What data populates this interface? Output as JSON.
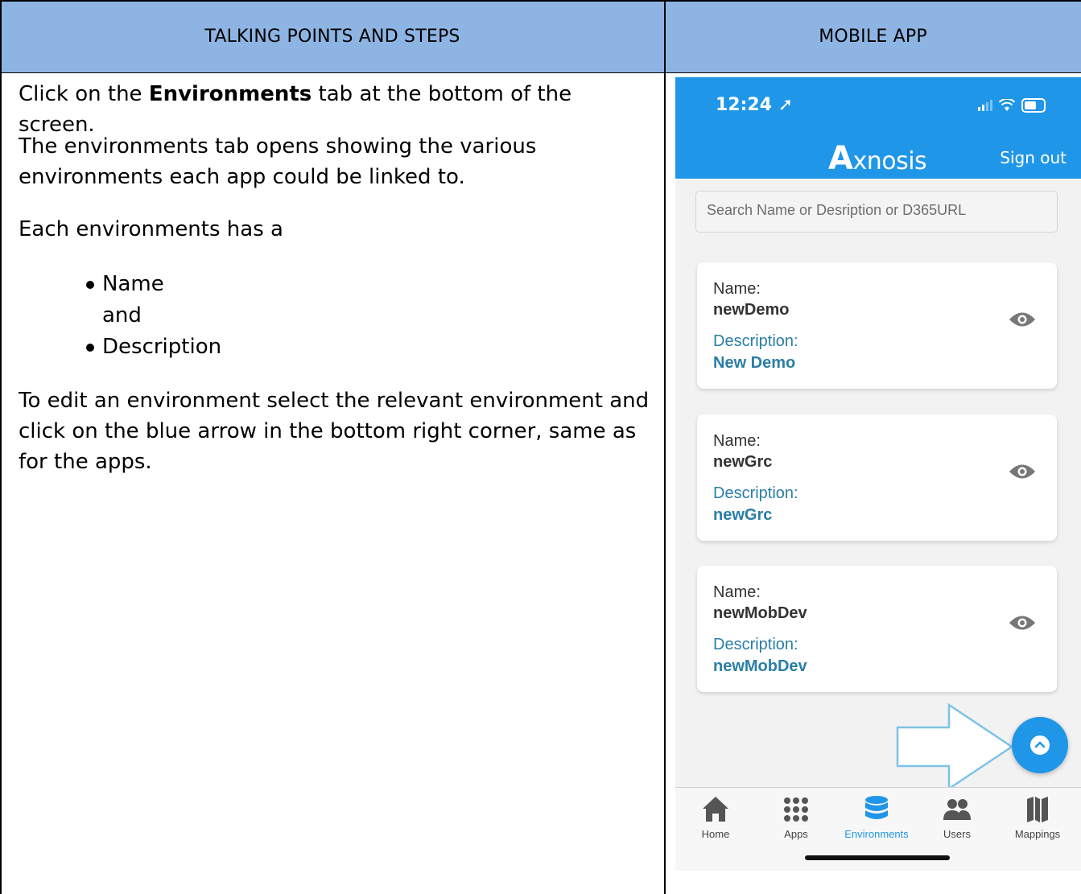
{
  "table": {
    "header_left": "TALKING POINTS AND STEPS",
    "header_right": "MOBILE APP"
  },
  "left": {
    "p1_pre": "Click on the ",
    "p1_bold": "Environments",
    "p1_post": " tab at the bottom of the screen.",
    "p2": "The environments tab opens showing the various environments each app could be linked to.",
    "p3": "Each environments has a",
    "bullets": [
      "Name",
      "Description"
    ],
    "bullet_connector": "and",
    "p4": "To edit an environment select the relevant environment and click on the blue arrow in the bottom right corner, same as for the apps."
  },
  "phone": {
    "time": "12:24",
    "logo_a": "A",
    "logo_rest": "xnosis",
    "signout": "Sign out",
    "search_placeholder": "Search Name or Desription or D365URL",
    "name_label": "Name:",
    "desc_label": "Description:",
    "cards": [
      {
        "name": "newDemo",
        "description": "New Demo"
      },
      {
        "name": "newGrc",
        "description": "newGrc"
      },
      {
        "name": "newMobDev",
        "description": "newMobDev"
      }
    ],
    "tabs": [
      {
        "label": "Home",
        "icon": "home-icon"
      },
      {
        "label": "Apps",
        "icon": "apps-grid-icon"
      },
      {
        "label": "Environments",
        "icon": "database-icon",
        "active": true
      },
      {
        "label": "Users",
        "icon": "users-icon"
      },
      {
        "label": "Mappings",
        "icon": "map-icon"
      }
    ],
    "colors": {
      "primary": "#1f96e8",
      "header_fill": "#8eb4e3",
      "description": "#2a7ea6"
    }
  }
}
